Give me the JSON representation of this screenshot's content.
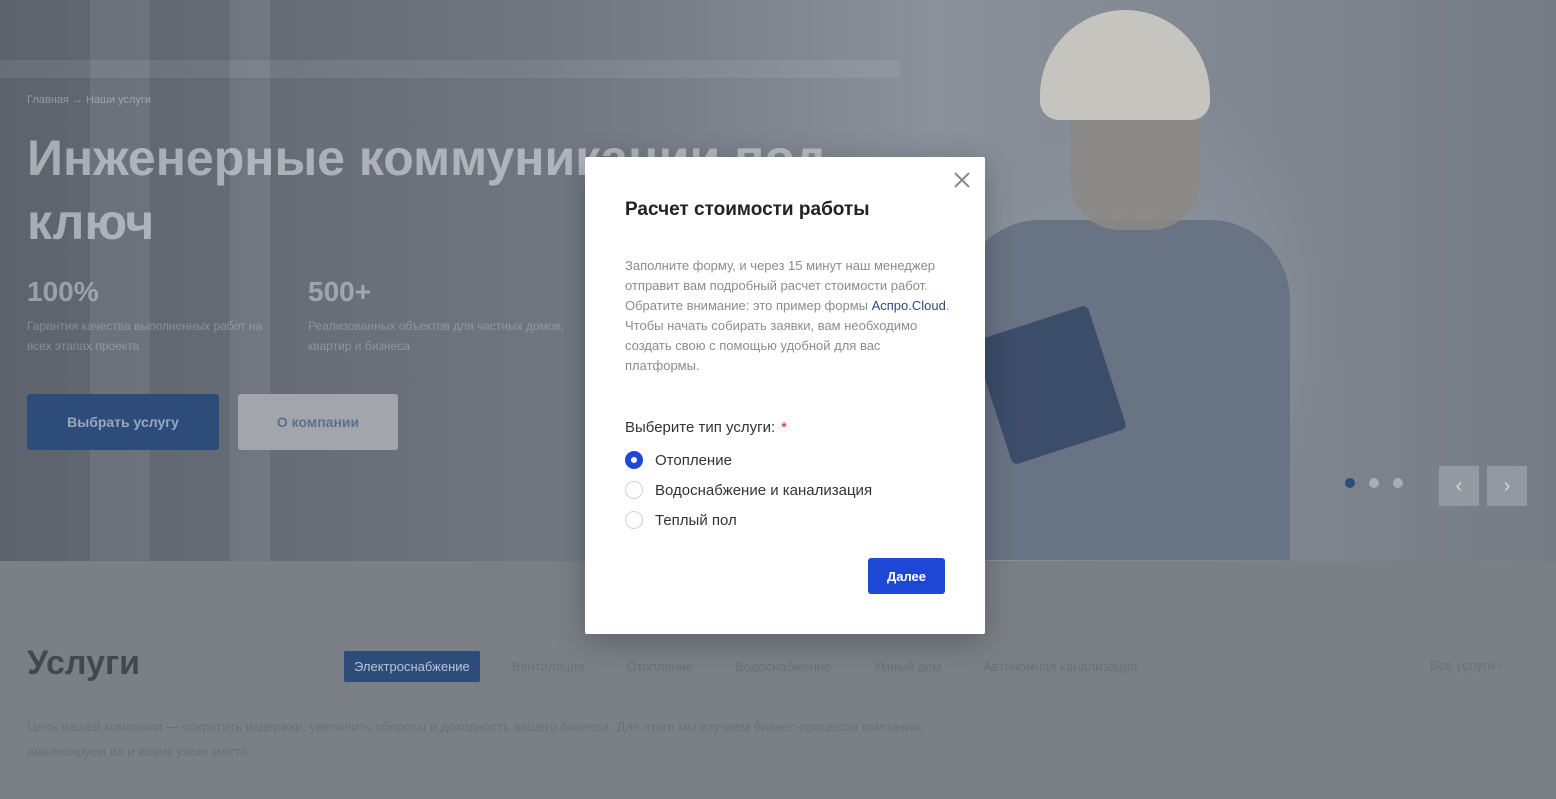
{
  "hero": {
    "breadcrumbs": "Главная → Наши услуги",
    "title": "Инженерные коммуникации под ключ",
    "stats": [
      {
        "num": "100%",
        "desc": "Гарантия качества выполненных работ на всех этапах проекта"
      },
      {
        "num": "500+",
        "desc": "Реализованных объектов для частных домов, квартир и бизнеса"
      }
    ],
    "primary_button": "Выбрать услугу",
    "secondary_button": "О компании",
    "prev_arrow": "‹",
    "next_arrow": "›"
  },
  "services": {
    "title": "Услуги",
    "tabs": [
      "Электроснабжение",
      "Вентиляция",
      "Отопление",
      "Водоснабжение",
      "Умный дом",
      "Автономная канализация"
    ],
    "all_link": "Все услуги  ›",
    "text": "Цель нашей компании — сократить издержки, увеличить обороты и доходность вашего бизнеса. Для этого мы изучаем бизнес-процессы компании, анализируем их и ищем узкие места."
  },
  "modal": {
    "title": "Расчет стоимости работы",
    "desc_part1": "Заполните форму, и через 15 минут наш менеджер отправит вам подробный расчет стоимости работ. Обратите внимание: это пример формы ",
    "desc_link": "Аспро.Cloud",
    "desc_part2": ". Чтобы начать собирать заявки, вам необходимо создать свою с помощью удобной для вас платформы.",
    "label": "Выберите тип услуги:",
    "required_mark": "*",
    "options": [
      {
        "label": "Отопление",
        "checked": true
      },
      {
        "label": "Водоснабжение и канализация",
        "checked": false
      },
      {
        "label": "Теплый пол",
        "checked": false
      }
    ],
    "next_button": "Далее"
  },
  "colors": {
    "accent": "#1f47d6",
    "link": "#2d4c7a",
    "required": "#e02020"
  }
}
